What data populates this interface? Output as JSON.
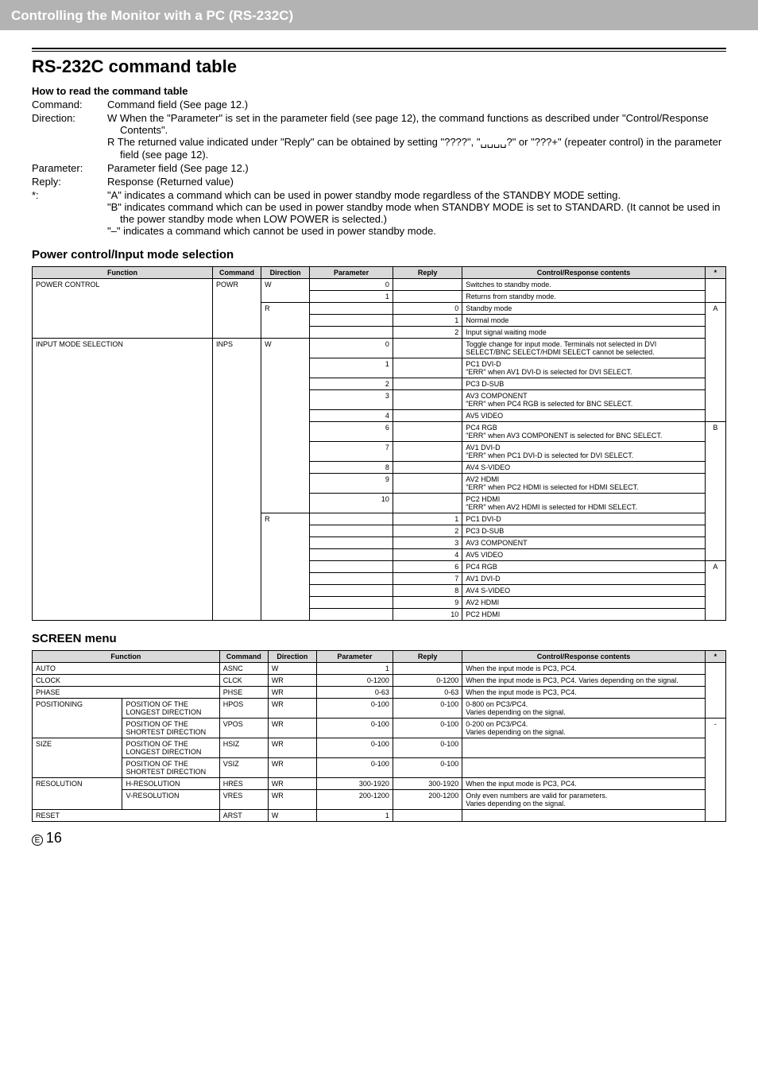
{
  "header": {
    "title": "Controlling the Monitor with a PC (RS-232C)"
  },
  "h1": "RS-232C command table",
  "howto": {
    "title": "How to read the command table",
    "rows": [
      {
        "label": "Command:",
        "lines": [
          "Command field (See page 12.)"
        ]
      },
      {
        "label": "Direction:",
        "lines": [
          "W  When the \"Parameter\" is set in the parameter field (see page 12), the command functions as described under \"Control/Response Contents\".",
          "R  The returned value indicated under \"Reply\" can be obtained by setting \"????\", \"␣␣␣␣?\" or \"???+\" (repeater control) in the parameter field (see page 12)."
        ]
      },
      {
        "label": "Parameter:",
        "lines": [
          "Parameter field (See page 12.)"
        ]
      },
      {
        "label": "Reply:",
        "lines": [
          "Response (Returned value)"
        ]
      },
      {
        "label": "*:",
        "lines": [
          "\"A\" indicates a command which can be used in power standby mode regardless of the STANDBY MODE setting.",
          "\"B\" indicates command which can be used in power standby mode when STANDBY MODE is set to STANDARD. (It cannot be used in the power standby mode when LOW POWER is selected.)",
          "\"–\" indicates a command which cannot be used in power standby mode."
        ]
      }
    ]
  },
  "sec1": {
    "title": "Power control/Input mode selection",
    "headers": [
      "Function",
      "Command",
      "Direction",
      "Parameter",
      "Reply",
      "Control/Response contents",
      "*"
    ],
    "rows": [
      {
        "func": "POWER CONTROL",
        "cmd": "POWR",
        "dir": "W",
        "param": "0",
        "reply": "",
        "desc": "Switches to standby mode.",
        "star": ""
      },
      {
        "func": "",
        "cmd": "",
        "dir": "",
        "param": "1",
        "reply": "",
        "desc": "Returns from standby mode.",
        "star": ""
      },
      {
        "func": "",
        "cmd": "",
        "dir": "R",
        "param": "",
        "reply": "0",
        "desc": "Standby mode",
        "star": "A"
      },
      {
        "func": "",
        "cmd": "",
        "dir": "",
        "param": "",
        "reply": "1",
        "desc": "Normal mode",
        "star": ""
      },
      {
        "func": "",
        "cmd": "",
        "dir": "",
        "param": "",
        "reply": "2",
        "desc": "Input signal waiting mode",
        "star": ""
      },
      {
        "func": "INPUT MODE SELECTION",
        "cmd": "INPS",
        "dir": "W",
        "param": "0",
        "reply": "",
        "desc": "Toggle change for input mode. Terminals not selected in DVI SELECT/BNC SELECT/HDMI SELECT cannot be selected.",
        "star": ""
      },
      {
        "func": "",
        "cmd": "",
        "dir": "",
        "param": "1",
        "reply": "",
        "desc": "PC1 DVI-D\n\"ERR\" when AV1 DVI-D is selected for DVI SELECT.",
        "star": ""
      },
      {
        "func": "",
        "cmd": "",
        "dir": "",
        "param": "2",
        "reply": "",
        "desc": "PC3 D-SUB",
        "star": ""
      },
      {
        "func": "",
        "cmd": "",
        "dir": "",
        "param": "3",
        "reply": "",
        "desc": "AV3 COMPONENT\n\"ERR\" when PC4 RGB is selected for BNC SELECT.",
        "star": ""
      },
      {
        "func": "",
        "cmd": "",
        "dir": "",
        "param": "4",
        "reply": "",
        "desc": "AV5 VIDEO",
        "star": ""
      },
      {
        "func": "",
        "cmd": "",
        "dir": "",
        "param": "6",
        "reply": "",
        "desc": "PC4 RGB\n\"ERR\" when AV3 COMPONENT is selected for BNC SELECT.",
        "star": "B"
      },
      {
        "func": "",
        "cmd": "",
        "dir": "",
        "param": "7",
        "reply": "",
        "desc": "AV1 DVI-D\n\"ERR\" when PC1 DVI-D is selected for DVI SELECT.",
        "star": ""
      },
      {
        "func": "",
        "cmd": "",
        "dir": "",
        "param": "8",
        "reply": "",
        "desc": "AV4 S-VIDEO",
        "star": ""
      },
      {
        "func": "",
        "cmd": "",
        "dir": "",
        "param": "9",
        "reply": "",
        "desc": "AV2 HDMI\n\"ERR\" when PC2 HDMI is selected for HDMI SELECT.",
        "star": ""
      },
      {
        "func": "",
        "cmd": "",
        "dir": "",
        "param": "10",
        "reply": "",
        "desc": "PC2 HDMI\n\"ERR\" when AV2 HDMI is selected for HDMI SELECT.",
        "star": ""
      },
      {
        "func": "",
        "cmd": "",
        "dir": "R",
        "param": "",
        "reply": "1",
        "desc": "PC1 DVI-D",
        "star": ""
      },
      {
        "func": "",
        "cmd": "",
        "dir": "",
        "param": "",
        "reply": "2",
        "desc": "PC3 D-SUB",
        "star": ""
      },
      {
        "func": "",
        "cmd": "",
        "dir": "",
        "param": "",
        "reply": "3",
        "desc": "AV3 COMPONENT",
        "star": ""
      },
      {
        "func": "",
        "cmd": "",
        "dir": "",
        "param": "",
        "reply": "4",
        "desc": "AV5 VIDEO",
        "star": ""
      },
      {
        "func": "",
        "cmd": "",
        "dir": "",
        "param": "",
        "reply": "6",
        "desc": "PC4 RGB",
        "star": "A"
      },
      {
        "func": "",
        "cmd": "",
        "dir": "",
        "param": "",
        "reply": "7",
        "desc": "AV1 DVI-D",
        "star": ""
      },
      {
        "func": "",
        "cmd": "",
        "dir": "",
        "param": "",
        "reply": "8",
        "desc": "AV4 S-VIDEO",
        "star": ""
      },
      {
        "func": "",
        "cmd": "",
        "dir": "",
        "param": "",
        "reply": "9",
        "desc": "AV2 HDMI",
        "star": ""
      },
      {
        "func": "",
        "cmd": "",
        "dir": "",
        "param": "",
        "reply": "10",
        "desc": "PC2 HDMI",
        "star": ""
      }
    ]
  },
  "sec2": {
    "title": "SCREEN menu",
    "headers": [
      "Function",
      "",
      "Command",
      "Direction",
      "Parameter",
      "Reply",
      "Control/Response contents",
      "*"
    ],
    "rows": [
      {
        "f1": "AUTO",
        "f2": "",
        "cmd": "ASNC",
        "dir": "W",
        "param": "1",
        "reply": "",
        "desc": "When the input mode is PC3, PC4.",
        "star": ""
      },
      {
        "f1": "CLOCK",
        "f2": "",
        "cmd": "CLCK",
        "dir": "WR",
        "param": "0-1200",
        "reply": "0-1200",
        "desc": "When the input mode is PC3, PC4. Varies depending on the signal.",
        "star": ""
      },
      {
        "f1": "PHASE",
        "f2": "",
        "cmd": "PHSE",
        "dir": "WR",
        "param": "0-63",
        "reply": "0-63",
        "desc": "When the input mode is PC3, PC4.",
        "star": ""
      },
      {
        "f1": "POSITIONING",
        "f2": "POSITION OF THE LONGEST DIRECTION",
        "cmd": "HPOS",
        "dir": "WR",
        "param": "0-100",
        "reply": "0-100",
        "desc": "0-800 on PC3/PC4.\nVaries depending on the signal.",
        "star": ""
      },
      {
        "f1": "",
        "f2": "POSITION OF THE SHORTEST DIRECTION",
        "cmd": "VPOS",
        "dir": "WR",
        "param": "0-100",
        "reply": "0-100",
        "desc": "0-200 on PC3/PC4.\nVaries depending on the signal.",
        "star": "-"
      },
      {
        "f1": "SIZE",
        "f2": "POSITION OF THE LONGEST DIRECTION",
        "cmd": "HSIZ",
        "dir": "WR",
        "param": "0-100",
        "reply": "0-100",
        "desc": "",
        "star": ""
      },
      {
        "f1": "",
        "f2": "POSITION OF THE SHORTEST DIRECTION",
        "cmd": "VSIZ",
        "dir": "WR",
        "param": "0-100",
        "reply": "0-100",
        "desc": "",
        "star": ""
      },
      {
        "f1": "RESOLUTION",
        "f2": "H-RESOLUTION",
        "cmd": "HRES",
        "dir": "WR",
        "param": "300-1920",
        "reply": "300-1920",
        "desc": "When the input mode is PC3, PC4.",
        "star": ""
      },
      {
        "f1": "",
        "f2": "V-RESOLUTION",
        "cmd": "VRES",
        "dir": "WR",
        "param": "200-1200",
        "reply": "200-1200",
        "desc": "Only even numbers are valid for parameters.\nVaries depending on the signal.",
        "star": ""
      },
      {
        "f1": "RESET",
        "f2": "",
        "cmd": "ARST",
        "dir": "W",
        "param": "1",
        "reply": "",
        "desc": "",
        "star": ""
      }
    ]
  },
  "footer": {
    "e": "E",
    "page": "16"
  }
}
